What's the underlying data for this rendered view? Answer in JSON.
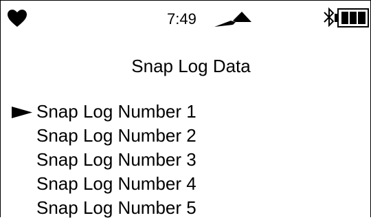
{
  "status_bar": {
    "time": "7:49",
    "icons": [
      "heart-icon",
      "signal-icon",
      "bluetooth-icon",
      "battery-icon"
    ],
    "battery_level": 1.0
  },
  "screen": {
    "title": "Snap Log Data"
  },
  "menu": {
    "selected_index": 0,
    "items": [
      {
        "label": "Snap Log Number 1"
      },
      {
        "label": "Snap Log Number 2"
      },
      {
        "label": "Snap Log Number 3"
      },
      {
        "label": "Snap Log Number 4"
      },
      {
        "label": "Snap Log Number 5"
      }
    ]
  },
  "colors": {
    "foreground": "#000000",
    "background": "#ffffff"
  }
}
